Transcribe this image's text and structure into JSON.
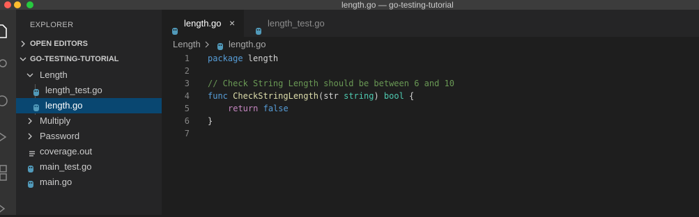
{
  "window": {
    "title": "length.go — go-testing-tutorial"
  },
  "explorer": {
    "title": "EXPLORER",
    "sections": {
      "open_editors": "OPEN EDITORS",
      "project": "GO-TESTING-TUTORIAL"
    },
    "tree": [
      {
        "label": "Length",
        "type": "folder",
        "expanded": true
      },
      {
        "label": "length_test.go",
        "type": "go-file"
      },
      {
        "label": "length.go",
        "type": "go-file",
        "selected": true
      },
      {
        "label": "Multiply",
        "type": "folder",
        "expanded": false
      },
      {
        "label": "Password",
        "type": "folder",
        "expanded": false
      },
      {
        "label": "coverage.out",
        "type": "text-file"
      },
      {
        "label": "main_test.go",
        "type": "go-file"
      },
      {
        "label": "main.go",
        "type": "go-file"
      }
    ]
  },
  "tabs": [
    {
      "label": "length.go",
      "active": true
    },
    {
      "label": "length_test.go",
      "active": false
    }
  ],
  "tab_close": "×",
  "breadcrumb": {
    "folder": "Length",
    "file": "length.go"
  },
  "code": {
    "line_numbers": [
      "1",
      "2",
      "3",
      "4",
      "5",
      "6",
      "7"
    ],
    "l1_package": "package",
    "l1_name": " length",
    "l3_comment": "// Check String Length should be between 6 and 10",
    "l4_func": "func",
    "l4_name": "CheckStringLength",
    "l4_open": "(str ",
    "l4_type": "string",
    "l4_close": ") ",
    "l4_ret": "bool",
    "l4_brace": " {",
    "l5_return": "return",
    "l5_false": "false",
    "l6_brace": "}"
  },
  "colors": {
    "accent": "#094771",
    "go_icon": "#519aba"
  }
}
